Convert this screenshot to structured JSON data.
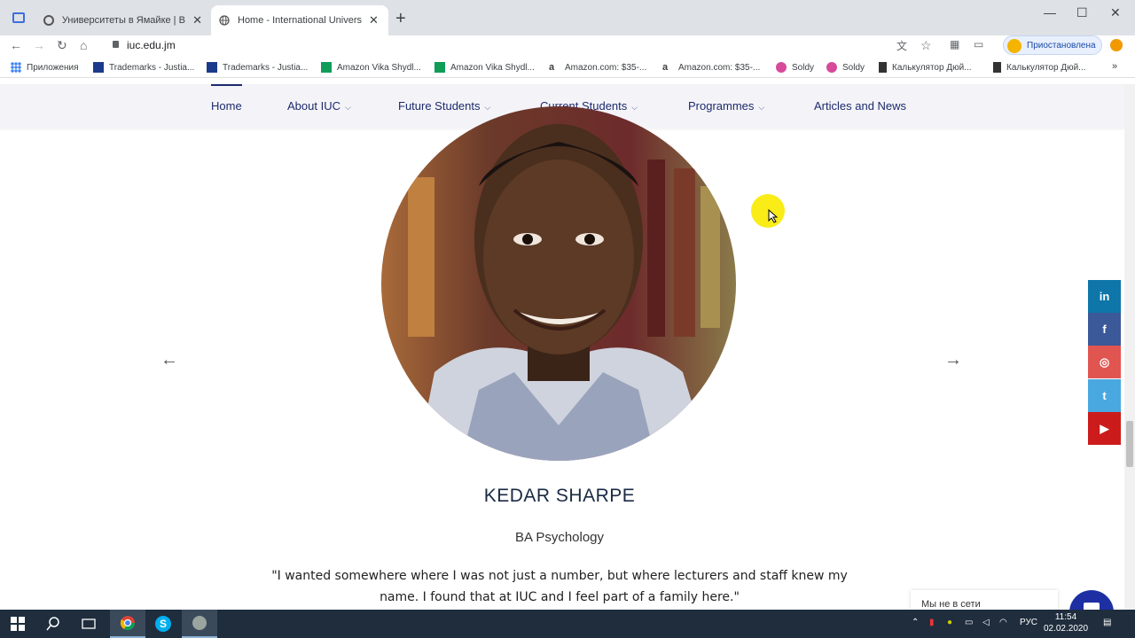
{
  "browser": {
    "tabs": [
      {
        "title": "Университеты в Ямайке | Всё о",
        "active": false
      },
      {
        "title": "Home - International University",
        "active": true
      }
    ],
    "url": "iuc.edu.jm",
    "profile_status": "Приостановлена"
  },
  "bookmarks": [
    {
      "label": "Приложения",
      "icon": "apps-grid-icon"
    },
    {
      "label": "Trademarks - Justia...",
      "icon": "justia-icon"
    },
    {
      "label": "Trademarks - Justia...",
      "icon": "justia-icon"
    },
    {
      "label": "Amazon Vika Shydl...",
      "icon": "sheets-icon"
    },
    {
      "label": "Amazon Vika Shydl...",
      "icon": "sheets-icon"
    },
    {
      "label": "Amazon.com: $35-...",
      "icon": "amazon-icon"
    },
    {
      "label": "Amazon.com: $35-...",
      "icon": "amazon-icon"
    },
    {
      "label": "Soldy",
      "icon": "soldy-icon"
    },
    {
      "label": "Soldy",
      "icon": "soldy-icon"
    },
    {
      "label": "Калькулятор Дюй...",
      "icon": "calculator-icon"
    },
    {
      "label": "Калькулятор Дюй...",
      "icon": "calculator-icon"
    }
  ],
  "site_nav": {
    "items": [
      {
        "label": "Home",
        "dropdown": false
      },
      {
        "label": "About IUC",
        "dropdown": true
      },
      {
        "label": "Future Students",
        "dropdown": true
      },
      {
        "label": "Current Students",
        "dropdown": true
      },
      {
        "label": "Programmes",
        "dropdown": true
      },
      {
        "label": "Articles and News",
        "dropdown": false
      }
    ]
  },
  "testimonial": {
    "name": "KEDAR SHARPE",
    "programme": "BA Psychology",
    "quote": "\"I wanted somewhere where I was not just a number, but where lecturers and staff knew my name. I found that at IUC and I feel part of a family here.\""
  },
  "social": [
    {
      "name": "linkedin",
      "glyph": "in",
      "color": "#0e76a8"
    },
    {
      "name": "facebook",
      "glyph": "f",
      "color": "#3b5998"
    },
    {
      "name": "instagram",
      "glyph": "◎",
      "color": "#e05550"
    },
    {
      "name": "twitter",
      "glyph": "t",
      "color": "#4aa8e0"
    },
    {
      "name": "youtube",
      "glyph": "▶",
      "color": "#cc1b1b"
    }
  ],
  "chat": {
    "status": "Мы не в сети"
  },
  "taskbar": {
    "language": "РУС",
    "time": "11:54",
    "date": "02.02.2020"
  }
}
